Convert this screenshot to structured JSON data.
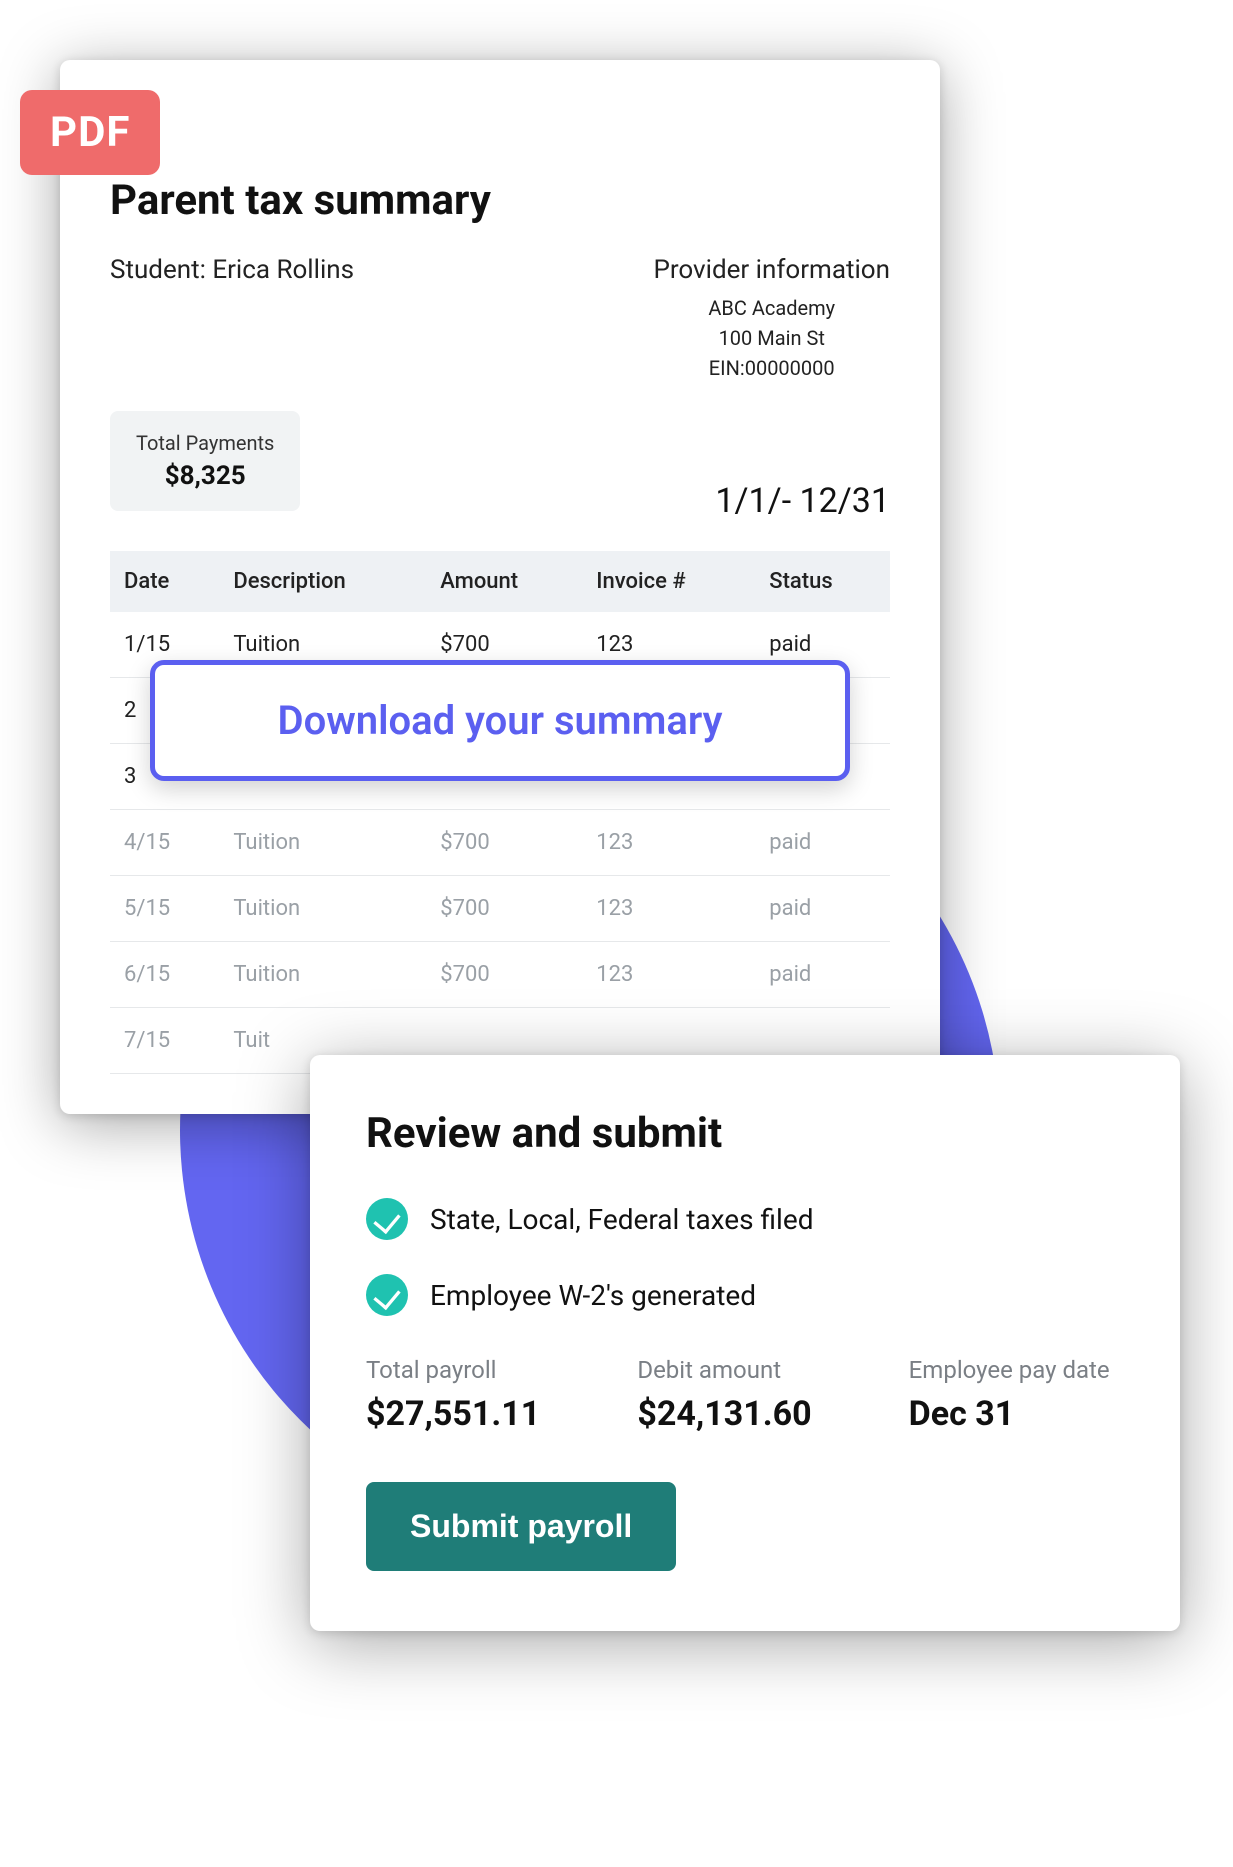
{
  "pdf_badge": "PDF",
  "tax_summary": {
    "title": "Parent tax summary",
    "student_label": "Student: Erica Rollins",
    "provider": {
      "heading": "Provider information",
      "name": "ABC Academy",
      "address": "100 Main St",
      "ein": "EIN:00000000"
    },
    "total_payments_label": "Total Payments",
    "total_payments_value": "$8,325",
    "date_range": "1/1/- 12/31",
    "columns": {
      "date": "Date",
      "description": "Description",
      "amount": "Amount",
      "invoice": "Invoice #",
      "status": "Status"
    },
    "rows": [
      {
        "date": "1/15",
        "description": "Tuition",
        "amount": "$700",
        "invoice": "123",
        "status": "paid",
        "faded": false
      },
      {
        "date": "2",
        "description": "",
        "amount": "",
        "invoice": "",
        "status": "",
        "faded": false
      },
      {
        "date": "3",
        "description": "",
        "amount": "",
        "invoice": "",
        "status": "",
        "faded": false
      },
      {
        "date": "4/15",
        "description": "Tuition",
        "amount": "$700",
        "invoice": "123",
        "status": "paid",
        "faded": true
      },
      {
        "date": "5/15",
        "description": "Tuition",
        "amount": "$700",
        "invoice": "123",
        "status": "paid",
        "faded": true
      },
      {
        "date": "6/15",
        "description": "Tuition",
        "amount": "$700",
        "invoice": "123",
        "status": "paid",
        "faded": true
      },
      {
        "date": "7/15",
        "description": "Tuit",
        "amount": "",
        "invoice": "",
        "status": "",
        "faded": true
      }
    ]
  },
  "download_button_label": "Download your summary",
  "review": {
    "title": "Review and submit",
    "checks": [
      "State, Local, Federal taxes filed",
      "Employee W-2's generated"
    ],
    "metrics": [
      {
        "label": "Total payroll",
        "value": "$27,551.11"
      },
      {
        "label": "Debit amount",
        "value": "$24,131.60"
      },
      {
        "label": "Employee pay date",
        "value": "Dec 31"
      }
    ],
    "submit_label": "Submit payroll"
  }
}
